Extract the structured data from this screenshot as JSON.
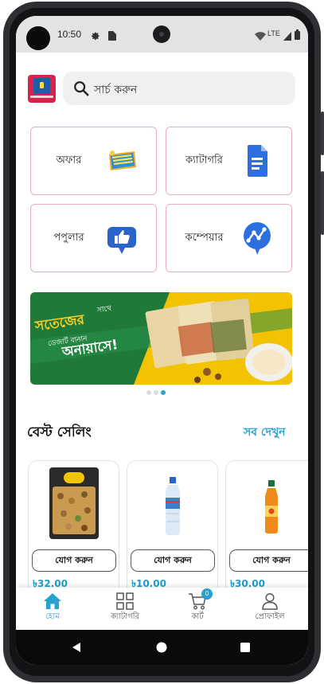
{
  "status_bar": {
    "time": "10:50",
    "network": "LTE",
    "icons": [
      "gear-icon",
      "sim-card-icon",
      "wifi-icon",
      "signal-icon",
      "battery-icon"
    ]
  },
  "header": {
    "logo_icon": "app-logo-icon",
    "search_placeholder": "সার্চ করুন"
  },
  "quick_links": [
    {
      "label": "অফার",
      "icon": "best-offer-icon"
    },
    {
      "label": "ক্যাটাগরি",
      "icon": "document-icon"
    },
    {
      "label": "পপুলার",
      "icon": "thumbs-up-icon"
    },
    {
      "label": "কম্পেয়ার",
      "icon": "compare-chart-icon"
    }
  ],
  "banner": {
    "headline": "সতেজের",
    "subline": "ডেজার্ট বানান",
    "tagline": "অনায়াসে!",
    "small": "সাথে",
    "slide_count": 3,
    "active_slide": 3
  },
  "best_selling": {
    "title": "বেস্ট সেলিং",
    "see_all": "সব দেখুন",
    "products": [
      {
        "price": "৳32.00",
        "add_label": "যোগ করুন",
        "image": "mixed-nuts-pack-image"
      },
      {
        "price": "৳10.00",
        "add_label": "যোগ করুন",
        "image": "water-bottle-image"
      },
      {
        "price": "৳30.00",
        "add_label": "যোগ করুন",
        "image": "juice-bottle-image"
      }
    ]
  },
  "bottom_nav": {
    "items": [
      {
        "label": "হোম",
        "icon": "home-icon",
        "active": true
      },
      {
        "label": "ক্যাটাগরি",
        "icon": "grid-icon",
        "active": false
      },
      {
        "label": "কার্ট",
        "icon": "cart-icon",
        "active": false,
        "badge": "0"
      },
      {
        "label": "প্রোফাইল",
        "icon": "profile-icon",
        "active": false
      }
    ]
  },
  "colors": {
    "accent": "#21a1cd",
    "tile_border": "#e8aec0",
    "banner_green": "#1f7a3a",
    "banner_yellow": "#f3c200"
  }
}
